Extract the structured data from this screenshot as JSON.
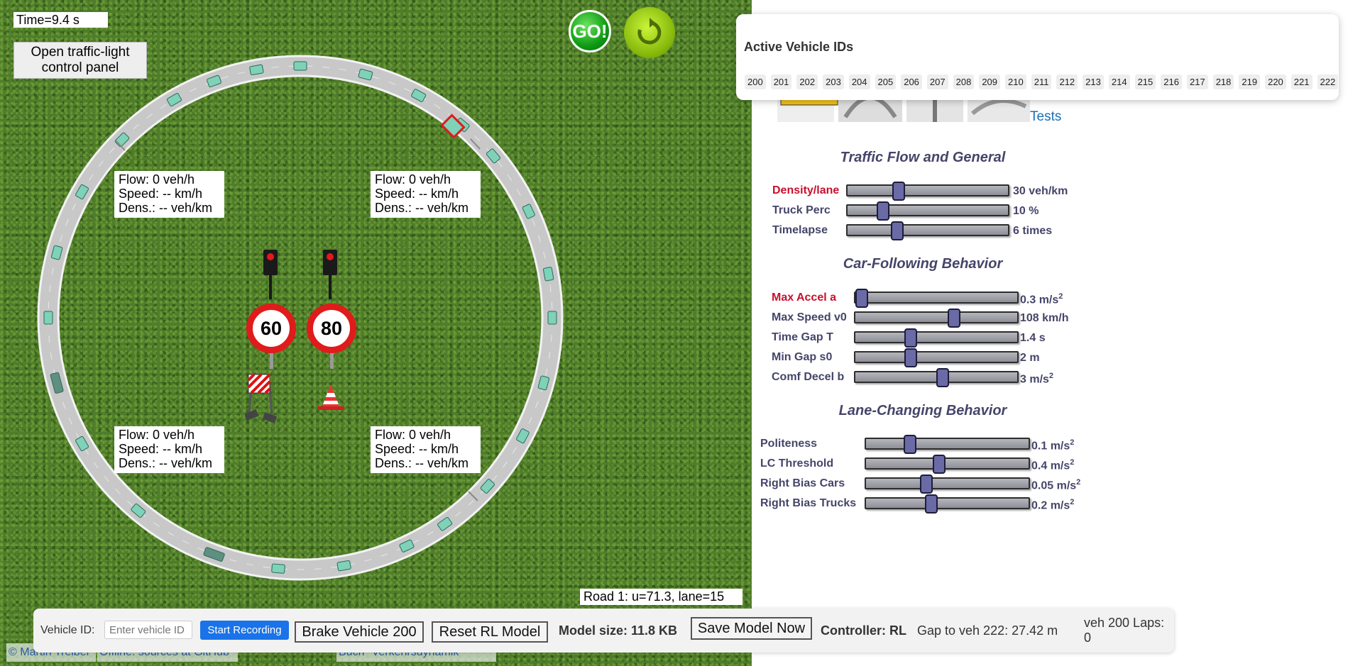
{
  "sim": {
    "time": "Time=9.4 s",
    "traffic_light_button": "Open traffic-light control panel",
    "go_label": "GO!",
    "speed_signs": [
      "60",
      "80"
    ],
    "detectors": [
      {
        "flow": "Flow: 0 veh/h",
        "speed": "Speed: -- km/h",
        "dens": "Dens.: -- veh/km"
      },
      {
        "flow": "Flow: 0 veh/h",
        "speed": "Speed: -- km/h",
        "dens": "Dens.: -- veh/km"
      },
      {
        "flow": "Flow: 0 veh/h",
        "speed": "Speed: -- km/h",
        "dens": "Dens.: -- veh/km"
      },
      {
        "flow": "Flow: 0 veh/h",
        "speed": "Speed: -- km/h",
        "dens": "Dens.: -- veh/km"
      }
    ],
    "road_info": "Road 1: u=71.3, lane=15",
    "credits": [
      "© Martin Treiber",
      "Offline: sources at GitHub",
      "Buch \"Verkehrsdynamik\""
    ]
  },
  "active_ids": {
    "title": "Active Vehicle IDs",
    "ids": [
      "200",
      "201",
      "202",
      "203",
      "204",
      "205",
      "206",
      "207",
      "208",
      "209",
      "210",
      "211",
      "212",
      "213",
      "214",
      "215",
      "216",
      "217",
      "218",
      "219",
      "220",
      "221",
      "222"
    ]
  },
  "tests_link": "Tests",
  "sections": {
    "traffic": "Traffic Flow and General",
    "car_following": "Car-Following Behavior",
    "lane_changing": "Lane-Changing Behavior"
  },
  "sliders": {
    "density": {
      "label": "Density/lane",
      "value": "30 veh/km",
      "fraction": 0.32
    },
    "truck": {
      "label": "Truck Perc",
      "value": "10 %",
      "fraction": 0.22
    },
    "timelapse": {
      "label": "Timelapse",
      "value": "6 times",
      "fraction": 0.31
    },
    "max_accel": {
      "label": "Max Accel a",
      "value": "0.3 m/s",
      "fraction": 0.04
    },
    "max_speed": {
      "label": "Max Speed v0",
      "value": "108 km/h",
      "fraction": 0.61
    },
    "time_gap": {
      "label": "Time Gap T",
      "value": "1.4 s",
      "fraction": 0.34
    },
    "min_gap": {
      "label": "Min Gap s0",
      "value": "2 m",
      "fraction": 0.34
    },
    "comf_decel": {
      "label": "Comf Decel b",
      "value": "3 m/s",
      "fraction": 0.54
    },
    "politeness": {
      "label": "Politeness",
      "value": "0.1 m/s",
      "fraction": 0.27
    },
    "lc_threshold": {
      "label": "LC Threshold",
      "value": "0.4 m/s",
      "fraction": 0.45
    },
    "bias_cars": {
      "label": "Right Bias Cars",
      "value": "0.05 m/s",
      "fraction": 0.37
    },
    "bias_trucks": {
      "label": "Right Bias Trucks",
      "value": "0.2 m/s",
      "fraction": 0.4
    }
  },
  "unit_sup": "2",
  "bottom": {
    "vehicle_id_label": "Vehicle ID:",
    "vehicle_id_placeholder": "Enter vehicle ID",
    "start_recording": "Start Recording",
    "brake_vehicle": "Brake Vehicle 200",
    "reset_rl": "Reset RL Model",
    "model_size": "Model size: 11.8 KB",
    "save_model": "Save Model Now",
    "controller": "Controller: RL",
    "gap": "Gap to veh 222: 27.42 m",
    "laps": "veh 200 Laps: 0"
  }
}
